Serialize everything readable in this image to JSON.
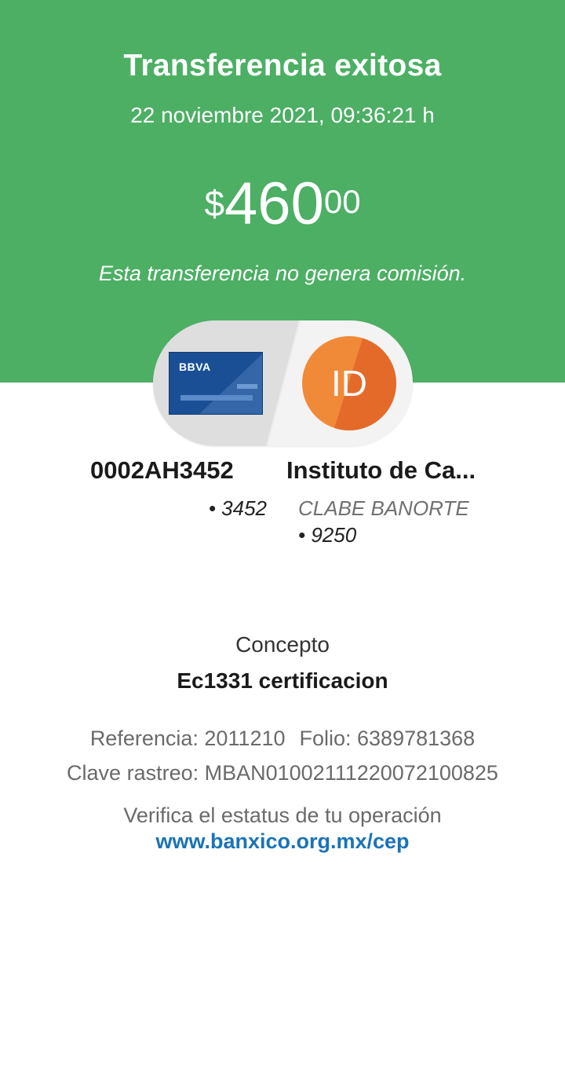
{
  "header": {
    "title": "Transferencia exitosa",
    "datetime": "22 noviembre 2021, 09:36:21 h"
  },
  "amount": {
    "currency": "$",
    "integer": "460",
    "decimals": "00"
  },
  "fee_note": "Esta transferencia no genera comisión.",
  "source": {
    "card_brand": "BBVA",
    "account_name": "0002AH3452",
    "account_tail": "• 3452"
  },
  "destination": {
    "avatar_initials": "ID",
    "name": "Instituto de Ca...",
    "bank": "CLABE BANORTE",
    "account_tail": "• 9250"
  },
  "concept": {
    "label": "Concepto",
    "value": "Ec1331 certificacion"
  },
  "references": {
    "reference": "Referencia: 2011210",
    "folio": "Folio: 6389781368",
    "tracking_key": "Clave rastreo: MBAN01002111220072100825"
  },
  "verify": {
    "text": "Verifica el estatus de tu operación",
    "link": "www.banxico.org.mx/cep"
  },
  "colors": {
    "hero_green": "#4caf64",
    "card_blue": "#1a4f96",
    "avatar_orange": "#f08a38",
    "link_blue": "#1a73b8"
  }
}
